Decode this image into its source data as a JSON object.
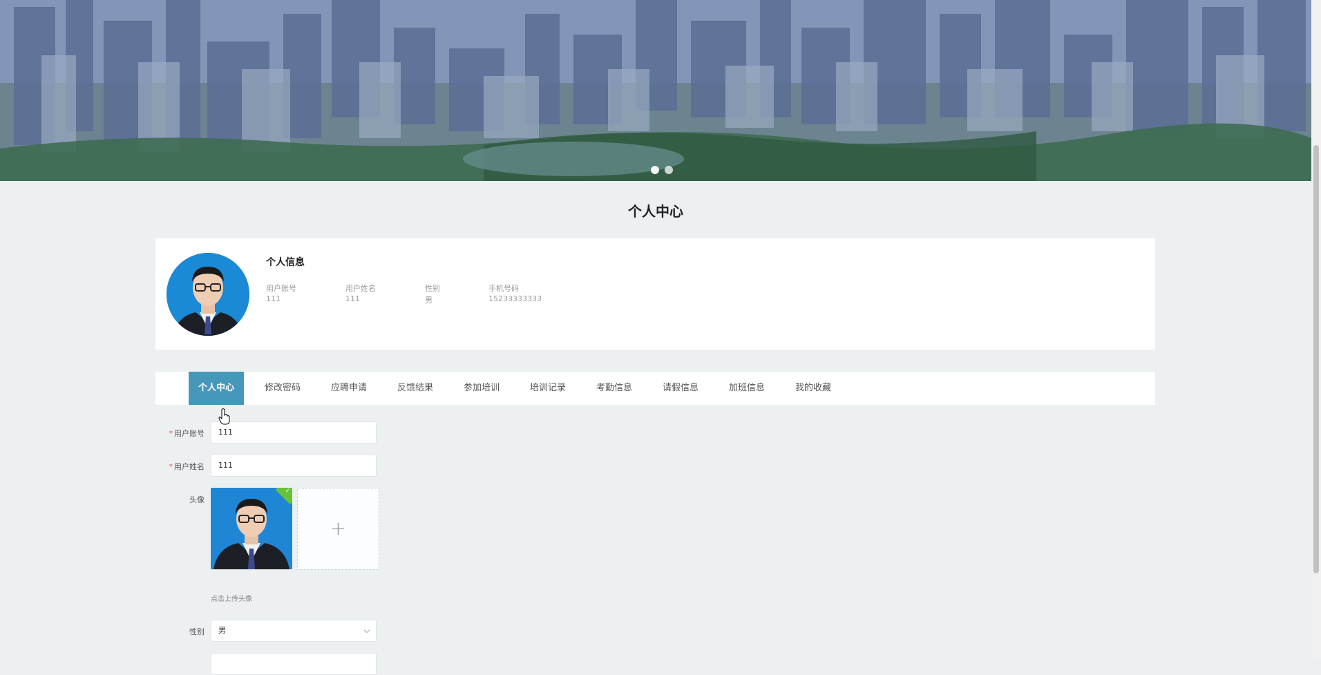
{
  "page": {
    "title": "个人中心"
  },
  "profile_card": {
    "heading": "个人信息",
    "fields": [
      {
        "label": "用户账号",
        "value": "111"
      },
      {
        "label": "用户姓名",
        "value": "111"
      },
      {
        "label": "性别",
        "value": "男"
      },
      {
        "label": "手机号码",
        "value": "15233333333"
      }
    ]
  },
  "tabs": [
    {
      "label": "个人中心",
      "active": true
    },
    {
      "label": "修改密码"
    },
    {
      "label": "应聘申请"
    },
    {
      "label": "反馈结果"
    },
    {
      "label": "参加培训"
    },
    {
      "label": "培训记录"
    },
    {
      "label": "考勤信息"
    },
    {
      "label": "请假信息"
    },
    {
      "label": "加班信息"
    },
    {
      "label": "我的收藏"
    }
  ],
  "form": {
    "account": {
      "label": "用户账号",
      "value": "111",
      "required": "*"
    },
    "name": {
      "label": "用户姓名",
      "value": "111",
      "required": "*"
    },
    "avatar": {
      "label": "头像",
      "hint": "点击上传头像",
      "add_symbol": "+"
    },
    "gender": {
      "label": "性别",
      "value": "男"
    }
  },
  "colors": {
    "accent": "#4698ba",
    "background": "#edf0f1",
    "required": "#e65757",
    "upload_success": "#67c23a"
  },
  "icons": {
    "carousel_dots": "carousel-dot",
    "upload": "plus-icon",
    "select": "chevron-down-icon",
    "success": "check-icon",
    "cursor": "hand-pointer-icon"
  }
}
